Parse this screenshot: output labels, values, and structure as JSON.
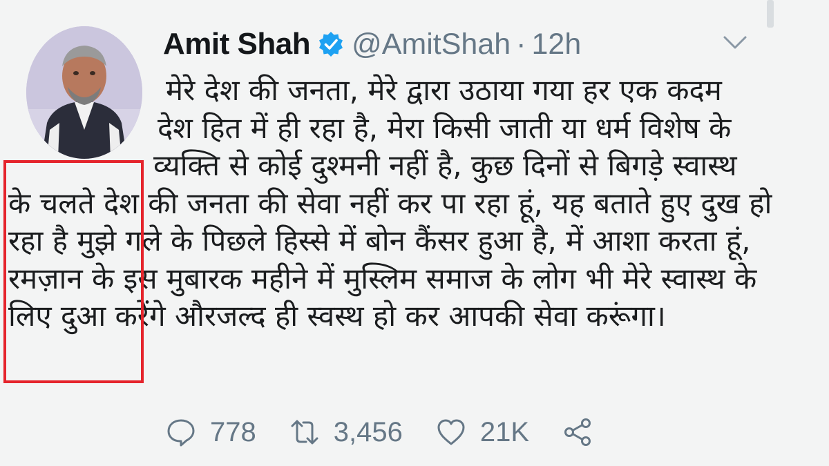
{
  "tweet": {
    "display_name": "Amit Shah",
    "handle": "@AmitShah",
    "separator": "·",
    "time": "12h",
    "verified_icon": "verified-badge-icon",
    "menu_icon": "chevron-down-icon",
    "lines": [
      "मेरे देश की जनता, मेरे द्वारा उठाया गया हर एक कदम",
      "देश हित में ही रहा है, मेरा किसी जाती या धर्म विशेष के",
      "व्यक्ति से कोई दुश्मनी नहीं है, कुछ दिनों से बिगड़े स्वास्थ",
      "के चलते देश की जनता की सेवा नहीं कर पा रहा हूं, यह बताते हुए दुख हो",
      "रहा है मुझे गले के पिछले हिस्से में बोन कैंसर हुआ है, में आशा करता हूं,",
      "रमज़ान के इस मुबारक महीने में मुस्लिम समाज के लोग भी मेरे स्वास्थ के",
      "लिए दुआ करेंगे औरजल्द ही स्वस्थ हो कर आपकी सेवा करूंगा।"
    ],
    "actions": {
      "reply_count": "778",
      "retweet_count": "3,456",
      "like_count": "21K"
    }
  },
  "colors": {
    "background": "#f3f4f4",
    "text": "#14171a",
    "muted": "#657786",
    "verified_blue": "#1da1f2",
    "highlight_red": "#e5242c"
  }
}
